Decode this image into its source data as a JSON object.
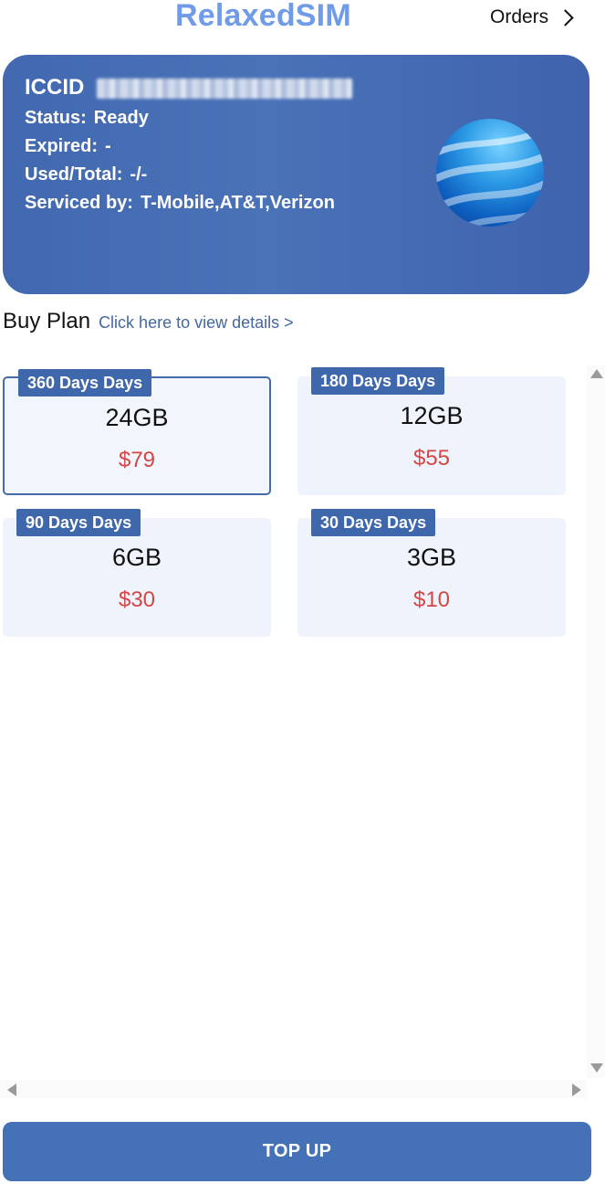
{
  "header": {
    "brand": "RelaxedSIM",
    "orders_label": "Orders"
  },
  "card": {
    "iccid_label": "ICCID",
    "status_label": "Status:",
    "status_value": "Ready",
    "expired_label": "Expired:",
    "expired_value": "-",
    "used_label": "Used/Total:",
    "used_value": "-/-",
    "serviced_label": "Serviced by:",
    "serviced_value": "T-Mobile,AT&T,Verizon"
  },
  "buy_plan": {
    "title": "Buy Plan",
    "details_link": "Click here to view details >"
  },
  "plans": [
    {
      "duration": "360 Days Days",
      "data": "24GB",
      "price": "$79",
      "selected": true
    },
    {
      "duration": "180 Days Days",
      "data": "12GB",
      "price": "$55",
      "selected": false
    },
    {
      "duration": "90 Days Days",
      "data": "6GB",
      "price": "$30",
      "selected": false
    },
    {
      "duration": "30 Days Days",
      "data": "3GB",
      "price": "$10",
      "selected": false
    }
  ],
  "topup_label": "TOP UP",
  "colors": {
    "brand": "#6f9be8",
    "card": "#4269b0",
    "badge": "#3f67ab",
    "price": "#d64545",
    "button": "#4571b6"
  },
  "icons": {
    "orders": "chevron-right-icon",
    "card": "globe-icon"
  }
}
